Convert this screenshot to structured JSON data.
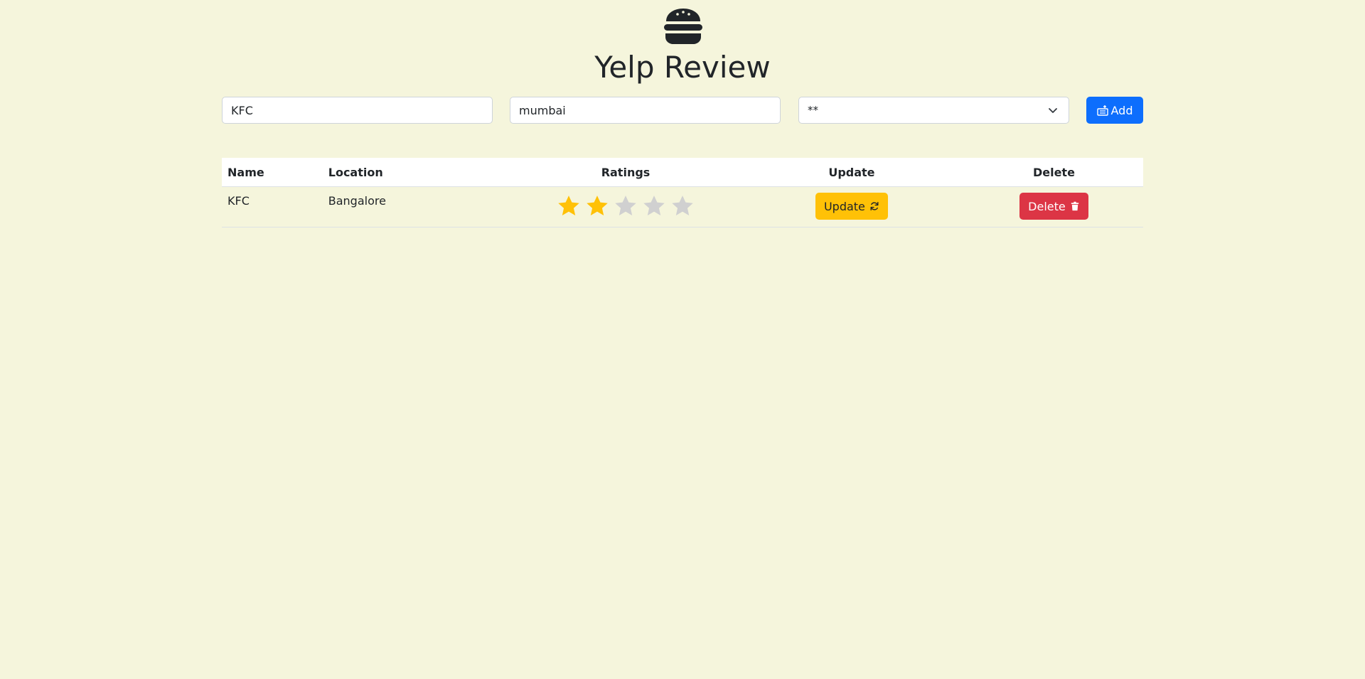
{
  "header": {
    "logo_icon": "burger-icon",
    "title": "Yelp Review"
  },
  "form": {
    "name_value": "KFC",
    "location_value": "mumbai",
    "rating_selected": "**",
    "add_label": "Add",
    "add_icon": "add-to-list-icon"
  },
  "table": {
    "headers": {
      "name": "Name",
      "location": "Location",
      "ratings": "Ratings",
      "update": "Update",
      "delete": "Delete"
    },
    "rows": [
      {
        "name": "KFC",
        "location": "Bangalore",
        "rating": 2,
        "rating_max": 5,
        "update_label": "Update",
        "update_icon": "refresh-icon",
        "delete_label": "Delete",
        "delete_icon": "trash-icon"
      }
    ]
  },
  "colors": {
    "background": "#f5f5dc",
    "primary": "#0d6efd",
    "warning": "#ffc107",
    "danger": "#dc3545",
    "star_filled": "#ffc107",
    "star_empty": "#d0d0d0"
  }
}
